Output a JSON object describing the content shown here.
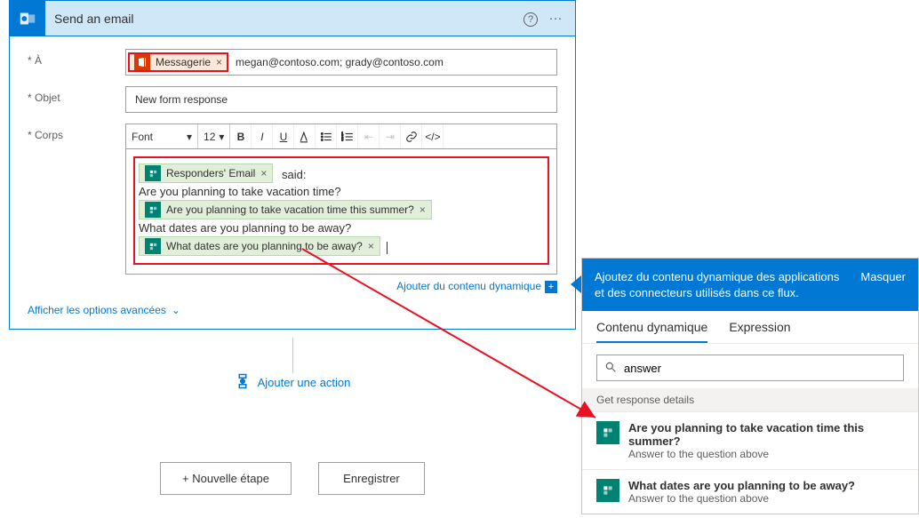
{
  "card": {
    "title": "Send an email",
    "helpIcon": "?",
    "moreIcon": "···",
    "labels": {
      "to": "* À",
      "subject": "* Objet",
      "body": "* Corps"
    },
    "to": {
      "token": "Messagerie",
      "value": "megan@contoso.com; grady@contoso.com"
    },
    "subject": "New form response",
    "rte": {
      "fontLabel": "Font",
      "sizeLabel": "12"
    },
    "body": {
      "token1": "Responders' Email",
      "said": "said:",
      "q1_line": "Are you planning to take vacation time?",
      "q1_token": "Are you planning to take vacation time this summer?",
      "q2_line": "What dates are you planning to be away?",
      "q2_token": "What dates are you planning to be away?"
    },
    "dynamicLink": "Ajouter du contenu dynamique",
    "advanced": "Afficher les options avancées"
  },
  "addAction": "Ajouter une action",
  "buttons": {
    "newStep": "+ Nouvelle étape",
    "save": "Enregistrer"
  },
  "panel": {
    "info": "Ajoutez du contenu dynamique des applications et des connecteurs utilisés dans ce flux.",
    "hide": "Masquer",
    "tabDynamic": "Contenu dynamique",
    "tabExpr": "Expression",
    "searchValue": "answer",
    "sectionHead": "Get response details",
    "items": [
      {
        "title": "Are you planning to take vacation time this summer?",
        "desc": "Answer to the question above"
      },
      {
        "title": "What dates are you planning to be away?",
        "desc": "Answer to the question above"
      }
    ]
  }
}
